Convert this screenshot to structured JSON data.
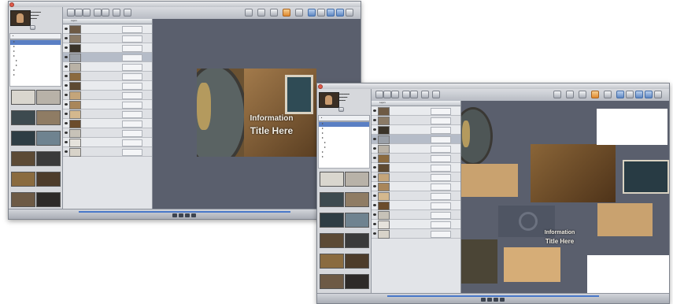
{
  "overlay": {
    "line1": "Information",
    "line2": "Title Here"
  },
  "layers": {
    "header": "Layers"
  },
  "window1": {
    "toolbar_buttons": 18,
    "layers": [
      {
        "thumb": "#6e5a44"
      },
      {
        "thumb": "#8a7a66"
      },
      {
        "thumb": "#3a3328"
      },
      {
        "thumb": "#9aa0a8",
        "sel": true
      },
      {
        "thumb": "#b9b2a6"
      },
      {
        "thumb": "#8b6a3e"
      },
      {
        "thumb": "#5e4a32"
      },
      {
        "thumb": "#c4a57a"
      },
      {
        "thumb": "#a9865a"
      },
      {
        "thumb": "#d4b88e"
      },
      {
        "thumb": "#6b4c2c"
      },
      {
        "thumb": "#c7c2b8"
      },
      {
        "thumb": "#e5e2dc"
      },
      {
        "thumb": "#d8d3c9"
      }
    ],
    "tree_rows": 8
  },
  "window2": {
    "layers": [
      {
        "thumb": "#6e5a44"
      },
      {
        "thumb": "#8a7a66"
      },
      {
        "thumb": "#3a3328"
      },
      {
        "thumb": "#9aa0a8",
        "sel": true
      },
      {
        "thumb": "#b9b2a6"
      },
      {
        "thumb": "#8b6a3e"
      },
      {
        "thumb": "#5e4a32"
      },
      {
        "thumb": "#c4a57a"
      },
      {
        "thumb": "#a9865a"
      },
      {
        "thumb": "#d4b88e"
      },
      {
        "thumb": "#6b4c2c"
      },
      {
        "thumb": "#c7c2b8"
      },
      {
        "thumb": "#e5e2dc"
      },
      {
        "thumb": "#d8d3c9"
      }
    ],
    "tree_rows": 8
  },
  "colors": {
    "canvas": "#5a5f6d",
    "accent_blue": "#4978c9",
    "selection": "#5a7fc4"
  },
  "icons": [
    "eye-icon",
    "folder-icon",
    "play-icon",
    "stop-icon",
    "rewind-icon",
    "forward-icon"
  ]
}
